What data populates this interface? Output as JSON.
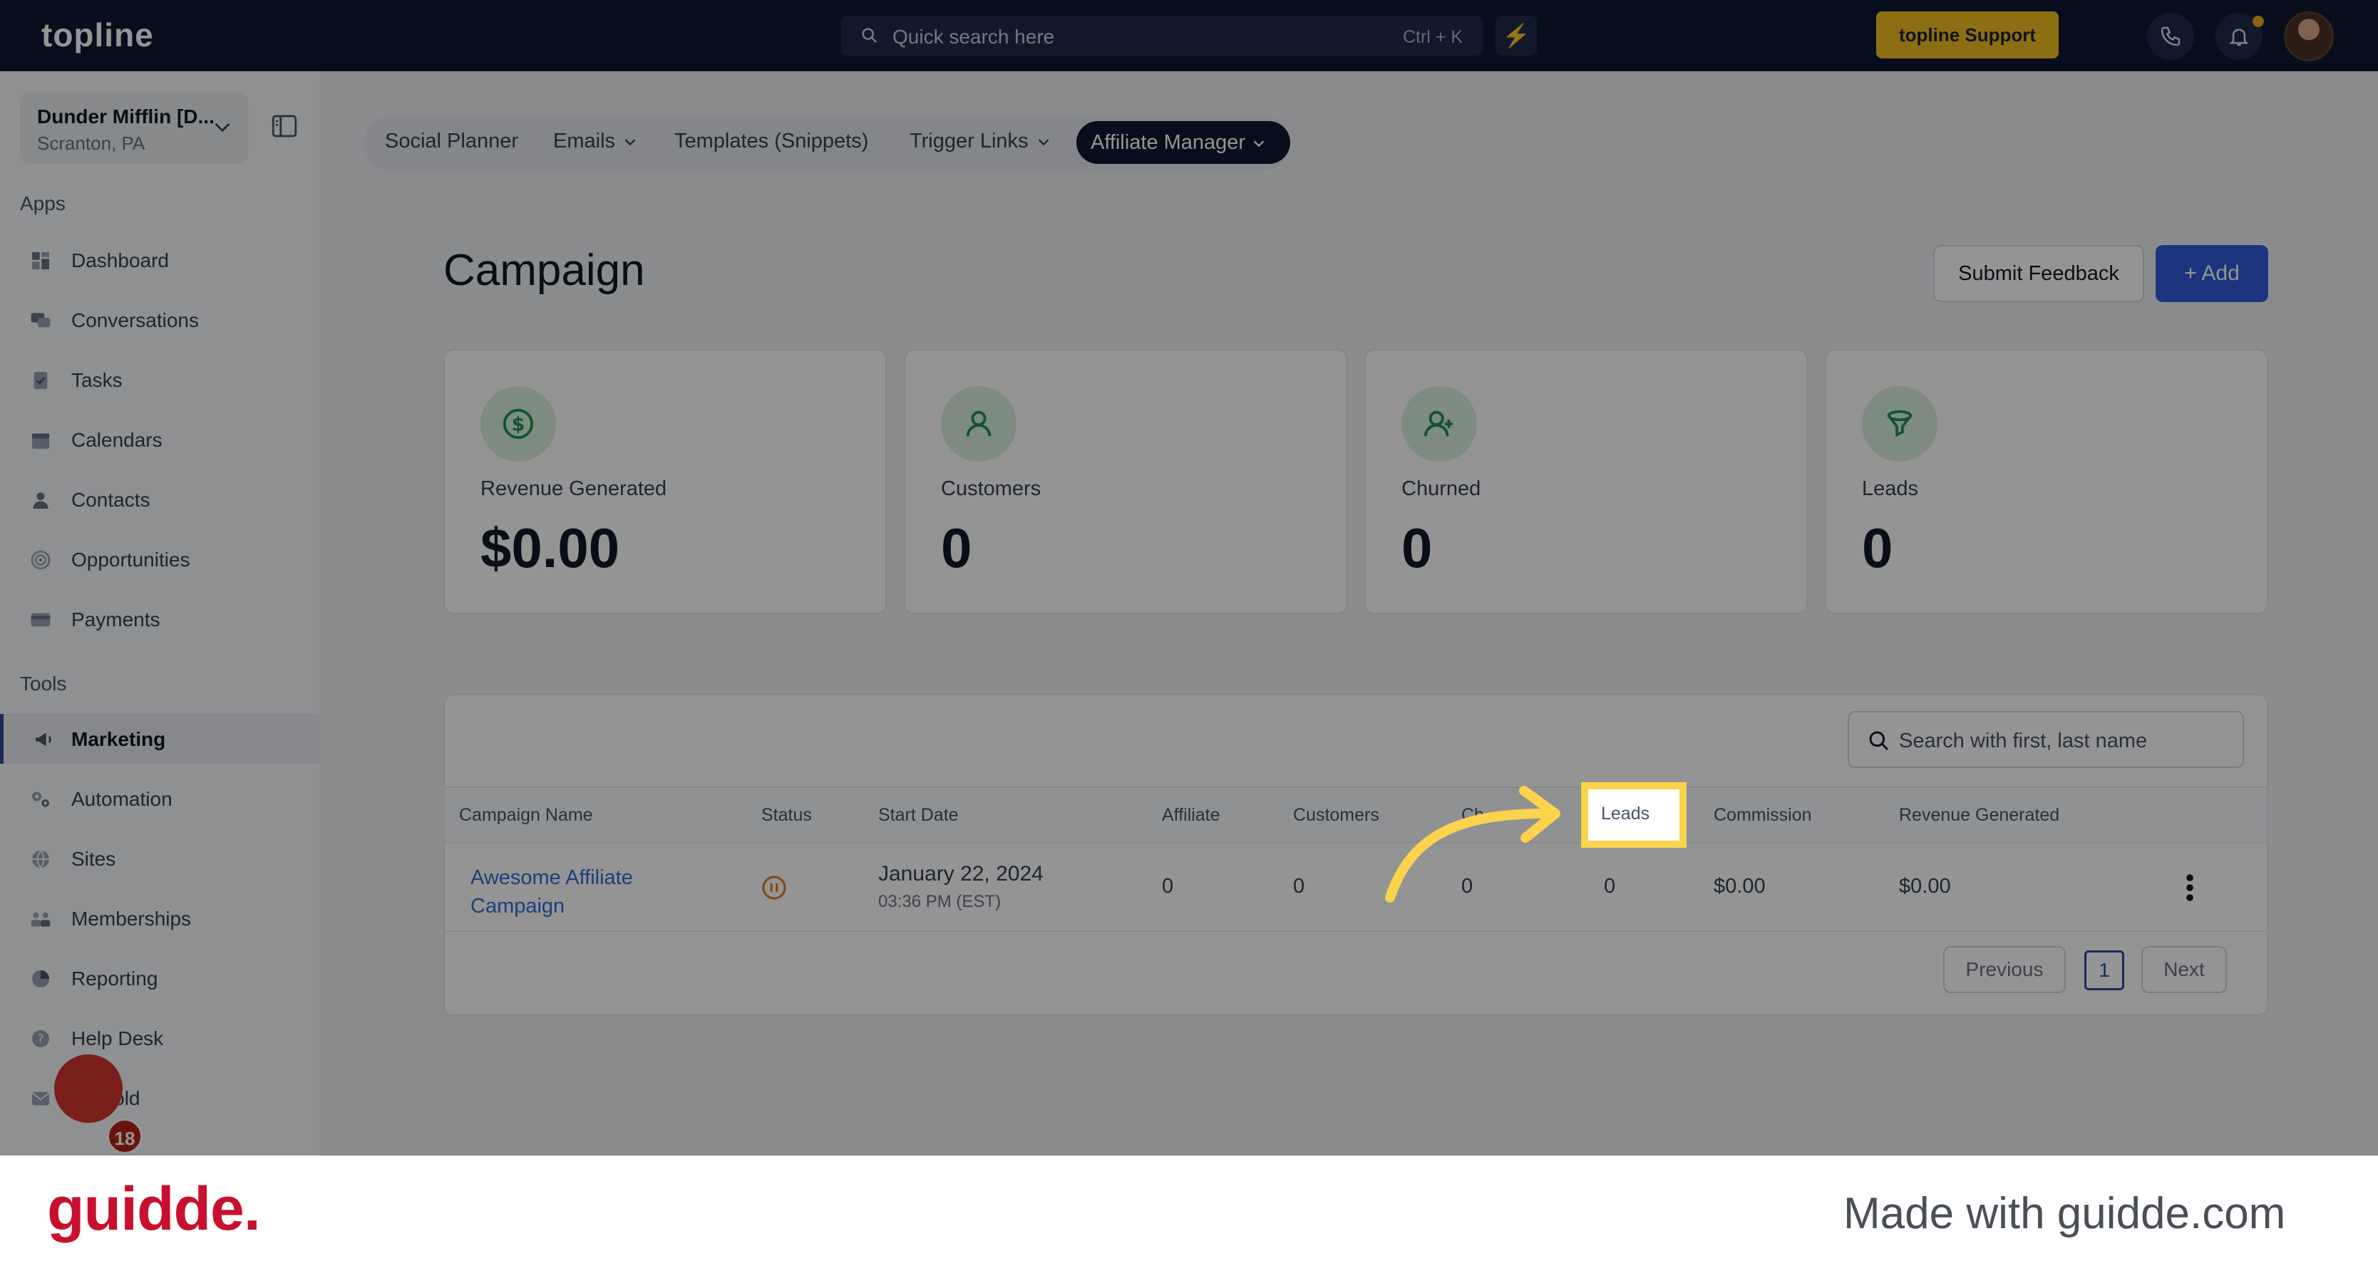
{
  "topbar": {
    "logo": "topline",
    "search_placeholder": "Quick search here",
    "search_shortcut": "Ctrl + K",
    "support_label": "topline Support"
  },
  "sidebar": {
    "location_name": "Dunder Mifflin [D...",
    "location_sub": "Scranton, PA",
    "apps_label": "Apps",
    "tools_label": "Tools",
    "apps": [
      {
        "label": "Dashboard",
        "icon": "dashboard-icon"
      },
      {
        "label": "Conversations",
        "icon": "chat-icon"
      },
      {
        "label": "Tasks",
        "icon": "tasks-icon"
      },
      {
        "label": "Calendars",
        "icon": "calendar-icon"
      },
      {
        "label": "Contacts",
        "icon": "contacts-icon"
      },
      {
        "label": "Opportunities",
        "icon": "target-icon"
      },
      {
        "label": "Payments",
        "icon": "card-icon"
      }
    ],
    "tools": [
      {
        "label": "Marketing",
        "icon": "megaphone-icon"
      },
      {
        "label": "Automation",
        "icon": "gears-icon"
      },
      {
        "label": "Sites",
        "icon": "globe-icon"
      },
      {
        "label": "Memberships",
        "icon": "members-icon"
      },
      {
        "label": "Reporting",
        "icon": "pie-icon"
      },
      {
        "label": "Help Desk",
        "icon": "help-icon"
      },
      {
        "label": "Mailfold",
        "icon": "mail-icon"
      }
    ],
    "chat_badge_count": "18"
  },
  "tabs": {
    "social_planner": "Social Planner",
    "emails": "Emails",
    "templates": "Templates (Snippets)",
    "trigger_links": "Trigger Links",
    "affiliate_manager": "Affiliate Manager"
  },
  "page": {
    "title": "Campaign",
    "feedback_label": "Submit Feedback",
    "add_label": "+ Add"
  },
  "stats": [
    {
      "label": "Revenue Generated",
      "value": "$0.00"
    },
    {
      "label": "Customers",
      "value": "0"
    },
    {
      "label": "Churned",
      "value": "0"
    },
    {
      "label": "Leads",
      "value": "0"
    }
  ],
  "table": {
    "search_placeholder": "Search with first, last name",
    "headers": {
      "campaign": "Campaign Name",
      "status": "Status",
      "start": "Start Date",
      "affiliate": "Affiliate",
      "customers": "Customers",
      "churned": "Ch",
      "leads": "Leads",
      "commission": "Commission",
      "revenue": "Revenue Generated"
    },
    "row": {
      "campaign": "Awesome Affiliate Campaign",
      "date": "January 22, 2024",
      "time": "03:36 PM (EST)",
      "affiliate": "0",
      "customers": "0",
      "churned": "0",
      "leads": "0",
      "commission": "$0.00",
      "revenue": "$0.00"
    },
    "pagination": {
      "previous": "Previous",
      "current": "1",
      "next": "Next"
    }
  },
  "footer": {
    "brand": "guidde.",
    "made_with": "Made with guidde.com"
  },
  "colors": {
    "topbar": "#0f1833",
    "accent_blue": "#2f5bd8",
    "support_yellow": "#f0c020",
    "highlight_yellow": "#fcd34d",
    "guidde_red": "#c8102e"
  }
}
